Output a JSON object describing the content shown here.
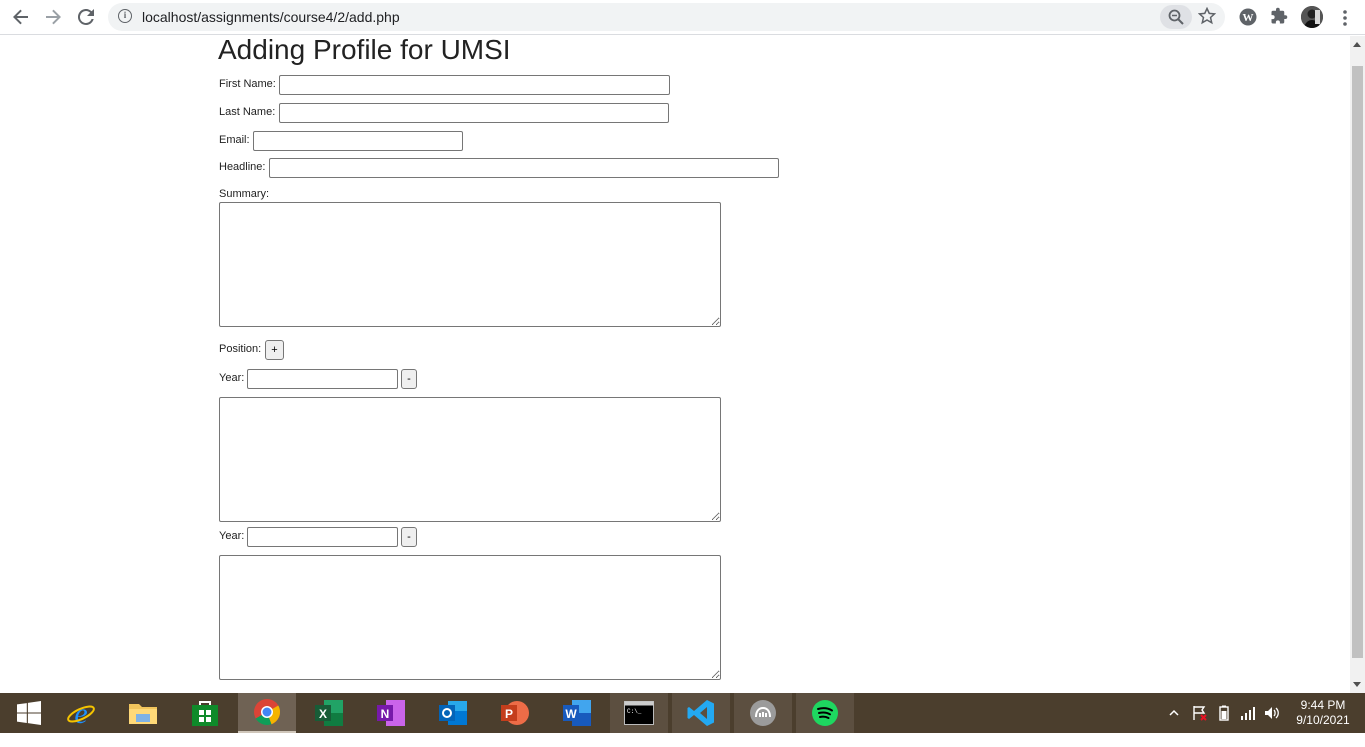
{
  "browser": {
    "url": "localhost/assignments/course4/2/add.php",
    "back_icon": "arrow-left-icon",
    "forward_icon": "arrow-right-icon",
    "reload_icon": "reload-icon",
    "info_icon": "info-icon",
    "info_glyph": "i"
  },
  "page": {
    "title": "Adding Profile for UMSI",
    "first_name_label": "First Name:",
    "last_name_label": "Last Name:",
    "email_label": "Email:",
    "headline_label": "Headline:",
    "summary_label": "Summary:",
    "position_label": "Position:",
    "add_position_button": "+",
    "positions": [
      {
        "year_label": "Year:",
        "year_value": "",
        "remove_button": "-",
        "description": ""
      },
      {
        "year_label": "Year:",
        "year_value": "",
        "remove_button": "-",
        "description": ""
      }
    ]
  },
  "taskbar": {
    "apps": [
      "start",
      "internet-explorer",
      "file-explorer",
      "microsoft-store",
      "chrome",
      "excel",
      "onenote",
      "outlook",
      "powerpoint",
      "word",
      "command-prompt",
      "vs-code",
      "mendeley",
      "spotify"
    ],
    "excel_letter": "X",
    "onenote_letter": "N",
    "powerpoint_letter": "P",
    "word_letter": "W",
    "cmd_text": "C:\\_",
    "time": "9:44 PM",
    "date": "9/10/2021"
  },
  "colors": {
    "taskbar_bg": "#4b3e2d",
    "chrome_active_bg": "#6f6254"
  }
}
